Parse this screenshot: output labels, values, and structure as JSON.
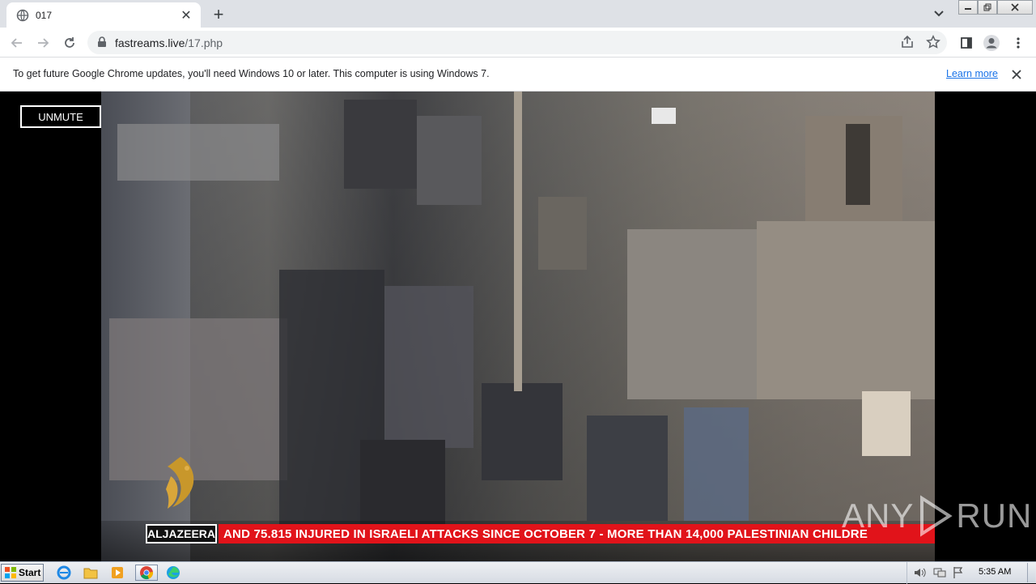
{
  "browser": {
    "tab_title": "017",
    "url_host": "fastreams.live",
    "url_path": "/17.php"
  },
  "infobar": {
    "message": "To get future Google Chrome updates, you'll need Windows 10 or later. This computer is using Windows 7.",
    "learn_more": "Learn more"
  },
  "video": {
    "unmute_label": "UNMUTE",
    "brand": "ALJAZEERA",
    "ticker": "AND 75.815 INJURED IN ISRAELI ATTACKS SINCE OCTOBER 7   -   MORE THAN 14,000 PALESTINIAN CHILDRE",
    "watermark": [
      "ANY",
      "RUN"
    ]
  },
  "taskbar": {
    "start_label": "Start",
    "clock": "5:35 AM"
  },
  "colors": {
    "ticker_red": "#e1131a",
    "link_blue": "#1a73e8"
  }
}
